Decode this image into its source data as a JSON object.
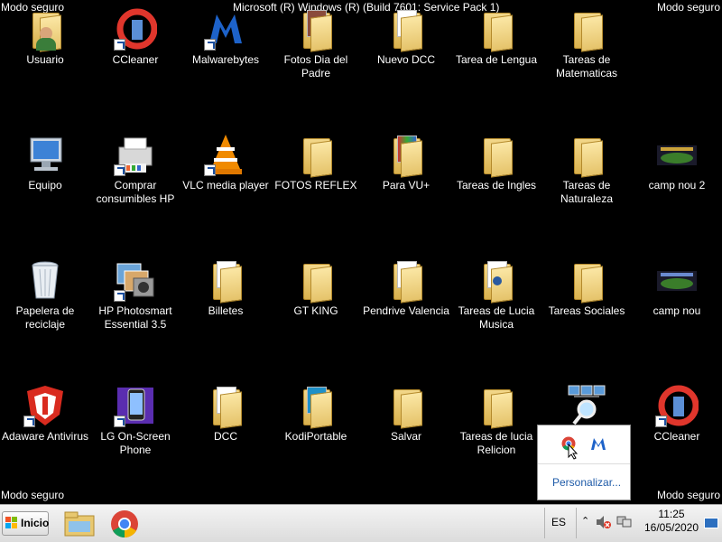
{
  "overlay": {
    "safe_mode": "Modo seguro",
    "build": "Microsoft (R) Windows (R) (Build 7601: Service Pack 1)"
  },
  "desktop": {
    "icons": [
      {
        "label": "Usuario"
      },
      {
        "label": "CCleaner"
      },
      {
        "label": "Malwarebytes"
      },
      {
        "label": "Fotos Dia del Padre"
      },
      {
        "label": "Nuevo DCC"
      },
      {
        "label": "Tarea de Lengua"
      },
      {
        "label": "Tareas de Matematicas"
      },
      {
        "label": "Equipo"
      },
      {
        "label": "Comprar consumibles HP"
      },
      {
        "label": "VLC media player"
      },
      {
        "label": "FOTOS REFLEX"
      },
      {
        "label": "Para VU+"
      },
      {
        "label": "Tareas de Ingles"
      },
      {
        "label": "Tareas de Naturaleza"
      },
      {
        "label": "camp nou 2"
      },
      {
        "label": "Papelera de reciclaje"
      },
      {
        "label": "HP Photosmart Essential 3.5"
      },
      {
        "label": "Billetes"
      },
      {
        "label": "GT KING"
      },
      {
        "label": "Pendrive Valencia"
      },
      {
        "label": "Tareas de Lucia Musica"
      },
      {
        "label": "Tareas Sociales"
      },
      {
        "label": "camp nou"
      },
      {
        "label": "Adaware Antivirus"
      },
      {
        "label": "LG On-Screen Phone"
      },
      {
        "label": "DCC"
      },
      {
        "label": "KodiPortable"
      },
      {
        "label": "Salvar"
      },
      {
        "label": "Tareas de lucia Relicion"
      },
      {
        "label": "CCleaner"
      }
    ]
  },
  "taskbar": {
    "start_label": "Inicio",
    "pinned": [
      "explorer-icon",
      "chrome-icon"
    ],
    "language": "ES",
    "time": "11:25",
    "date": "16/05/2020"
  },
  "tray_popup": {
    "icons": [
      "chrome-icon",
      "malwarebytes-icon"
    ],
    "customize_label": "Personalizar..."
  },
  "colors": {
    "desktop_bg": "#000000",
    "link": "#1d5aa8",
    "folder": "#e5c36a"
  }
}
